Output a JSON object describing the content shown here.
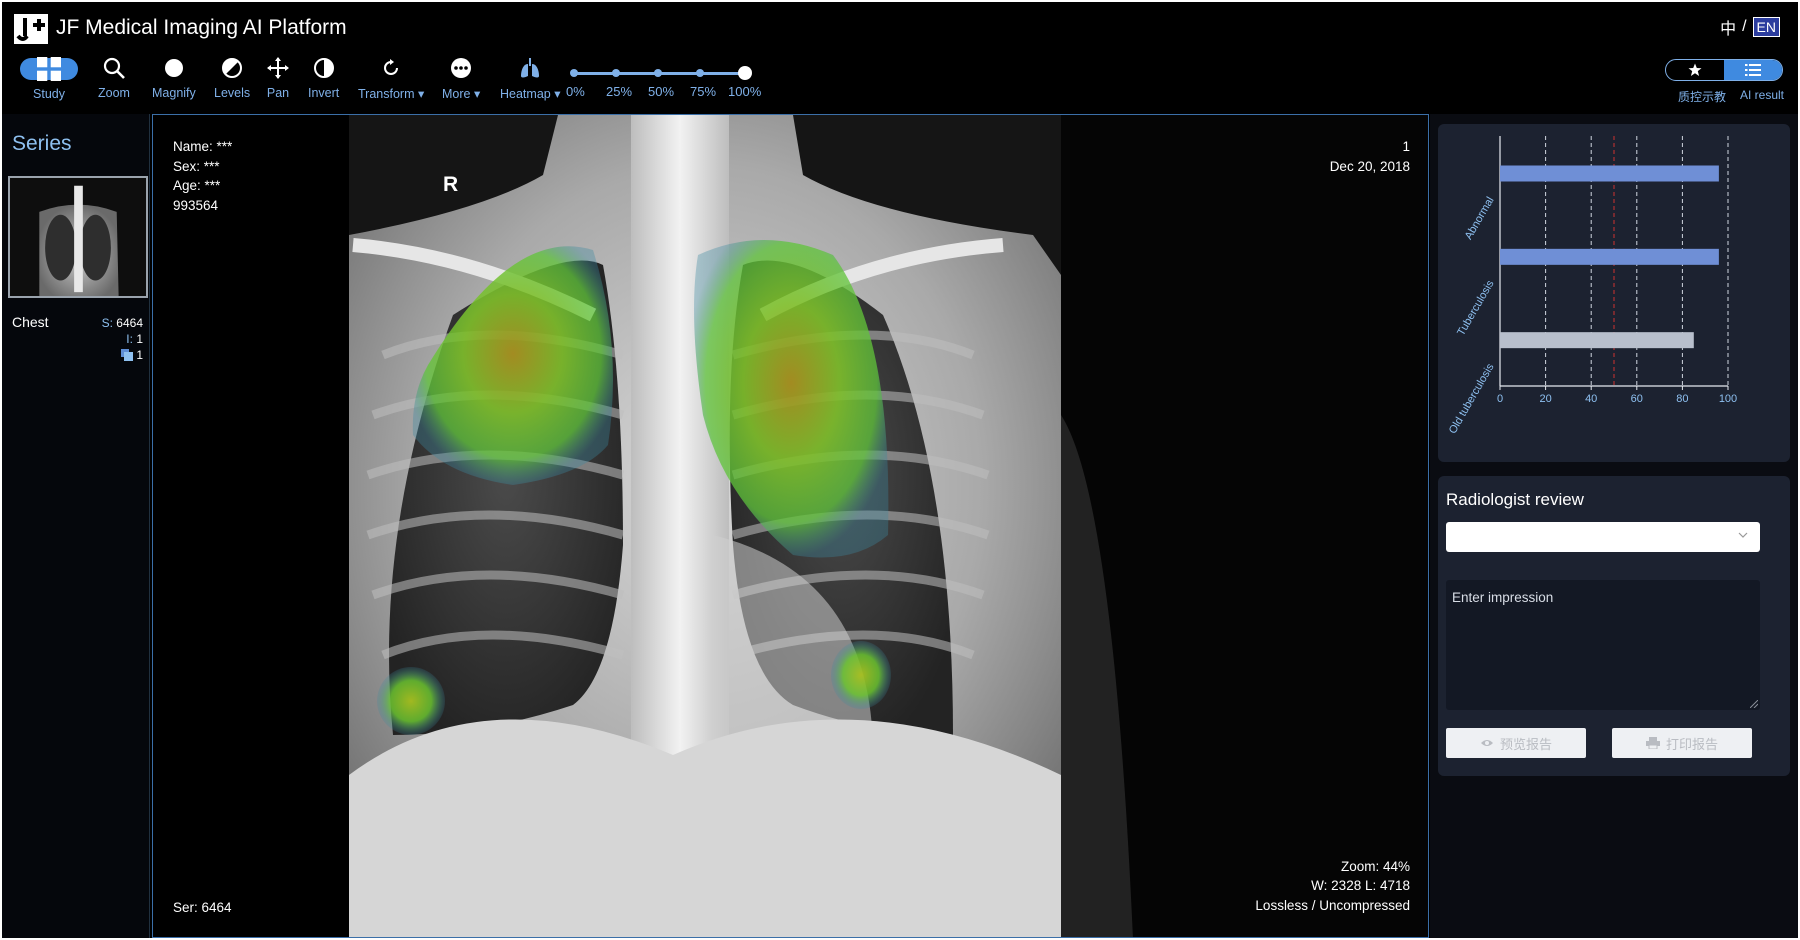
{
  "app": {
    "title": "JF Medical Imaging AI Platform",
    "lang_zh": "中",
    "lang_sep": "/",
    "lang_en": "EN"
  },
  "toolbar": {
    "items": [
      {
        "label": "Study",
        "icon": "grid-icon"
      },
      {
        "label": "Zoom",
        "icon": "search-icon"
      },
      {
        "label": "Magnify",
        "icon": "circle-icon"
      },
      {
        "label": "Levels",
        "icon": "contrast-icon"
      },
      {
        "label": "Pan",
        "icon": "move-icon"
      },
      {
        "label": "Invert",
        "icon": "invert-icon"
      },
      {
        "label": "Transform ▾",
        "icon": "rotate-icon"
      },
      {
        "label": "More ▾",
        "icon": "more-icon"
      },
      {
        "label": "Heatmap ▾",
        "icon": "lungs-icon"
      }
    ],
    "heatmap_opacity": {
      "labels": [
        "0%",
        "25%",
        "50%",
        "75%",
        "100%"
      ],
      "value_percent": 100
    },
    "view_toggle": {
      "labels": [
        "质控示教",
        "AI result"
      ],
      "active_index": 1
    }
  },
  "series": {
    "title": "Series",
    "name": "Chest",
    "s_label": "S:",
    "s_value": "6464",
    "i_label": "I:",
    "i_value": "1",
    "count": "1"
  },
  "viewer": {
    "name_line": "Name:  ***",
    "sex_line": "Sex:  ***",
    "age_line": "Age:  ***",
    "patient_id": "993564",
    "orientation": "R",
    "image_number": "1",
    "study_date": "Dec 20, 2018",
    "series_line": "Ser: 6464",
    "zoom_line": "Zoom: 44%",
    "window_line": "W: 2328 L: 4718",
    "compression_line": "Lossless / Uncompressed"
  },
  "chart_data": {
    "type": "bar",
    "orientation": "horizontal",
    "categories": [
      "Abnormal",
      "Tuberculosis",
      "Old tuberculosis"
    ],
    "values": [
      96,
      96,
      85
    ],
    "xlim": [
      0,
      100
    ],
    "xticks": [
      0,
      20,
      40,
      60,
      80,
      100
    ],
    "threshold": 50,
    "bar_colors": [
      "#6f8fd6",
      "#6f8fd6",
      "#b8bfcc"
    ],
    "threshold_color": "#b03030",
    "grid": true
  },
  "review": {
    "title": "Radiologist review",
    "select_value": "",
    "impression_placeholder": "Enter impression",
    "preview_label": "预览报告",
    "print_label": "打印报告"
  }
}
